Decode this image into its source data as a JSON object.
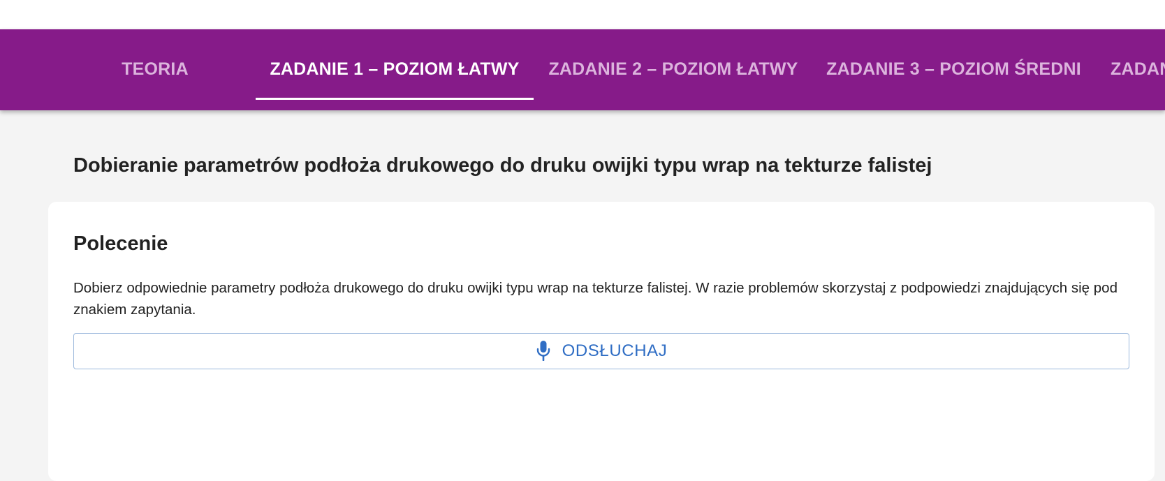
{
  "tabs": [
    {
      "label": "TEORIA",
      "active": false
    },
    {
      "label": "ZADANIE 1 – POZIOM ŁATWY",
      "active": true
    },
    {
      "label": "ZADANIE 2 – POZIOM ŁATWY",
      "active": false
    },
    {
      "label": "ZADANIE 3 – POZIOM ŚREDNI",
      "active": false
    },
    {
      "label": "ZADAN",
      "active": false
    }
  ],
  "page": {
    "title": "Dobieranie parametrów podłoża drukowego do druku owijki typu wrap na tekturze falistej"
  },
  "card": {
    "heading": "Polecenie",
    "instruction": "Dobierz odpowiednie parametry podłoża drukowego do druku owijki typu wrap na tekturze falistej. W razie problemów skorzystaj z podpowiedzi znajdujących się pod znakiem zapytania.",
    "listen_button": {
      "icon": "microphone-icon",
      "label": "ODSŁUCHAJ"
    }
  },
  "colors": {
    "tabbar_bg": "#861b89",
    "tab_inactive_text": "#dcb4dd",
    "tab_active_text": "#ffffff",
    "page_bg": "#f4f4f4",
    "accent_blue": "#2f6dc4"
  }
}
